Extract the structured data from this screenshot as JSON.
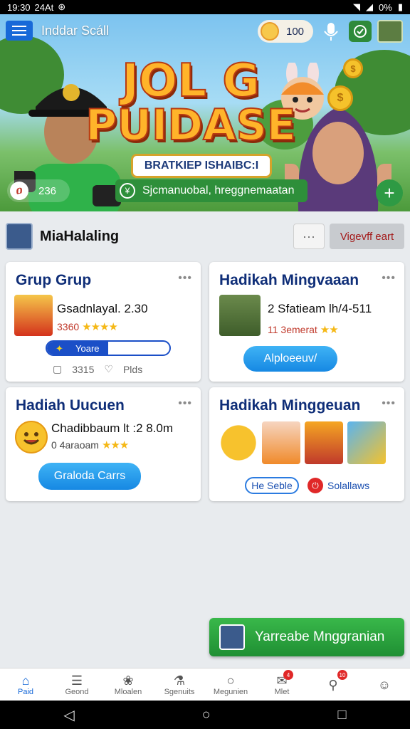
{
  "status_bar": {
    "time": "19:30",
    "carrier": "24At",
    "battery": "0%"
  },
  "header": {
    "app_title": "Inddar Scáll",
    "coins": "100"
  },
  "banner": {
    "title_line1": "JOL G",
    "title_line2": "PUIDASE",
    "subtitle": "BRATKIEP ISHAIBC:I",
    "likes": "236",
    "promo_text": "Sjcmanuobal, hreggnemaatan"
  },
  "user": {
    "name": "MiaHalaling",
    "more_label": "···",
    "view_label": "Vigevff eart"
  },
  "cards": [
    {
      "title": "Grup Grup",
      "item_title": "Gsadnlayal. 2.30",
      "item_sub": "3360",
      "stars": "★★★★",
      "progress_label": "Yoare",
      "progress_value": 0.5,
      "stat1": "3315",
      "stat2": "Plds"
    },
    {
      "title": "Hadikah Mingvaaan",
      "item_title": "2 Sfatieam lh/4-511",
      "item_sub": "11 3emerat",
      "stars": "★★",
      "button_label": "Alploeeuv/"
    },
    {
      "title": "Hadiah Uucuen",
      "item_title": "Chadibbaum lt :2 8.0m",
      "item_sub": "0 4araoam",
      "stars": "★★★",
      "button_label": "Graloda Carrs"
    },
    {
      "title": "Hadikah Minggeuan",
      "chip1": "He Seble",
      "chip2": "Solallaws"
    }
  ],
  "cta": {
    "label": "Yarreabe Mnggranian"
  },
  "bottom_nav": [
    {
      "label": "Paid",
      "icon": "home-icon"
    },
    {
      "label": "Geond",
      "icon": "list-icon"
    },
    {
      "label": "Mloalen",
      "icon": "group-icon"
    },
    {
      "label": "Sgenuits",
      "icon": "flask-icon"
    },
    {
      "label": "Megunien",
      "icon": "circle-icon"
    },
    {
      "label": "Mlet",
      "icon": "mail-icon",
      "badge": "4"
    },
    {
      "label": "",
      "icon": "pin-icon",
      "badge": "10"
    },
    {
      "label": "",
      "icon": "smile-icon"
    }
  ],
  "colors": {
    "accent": "#1769d8",
    "title_blue": "#0f2e78",
    "green": "#2e9a44",
    "red": "#e02828"
  }
}
